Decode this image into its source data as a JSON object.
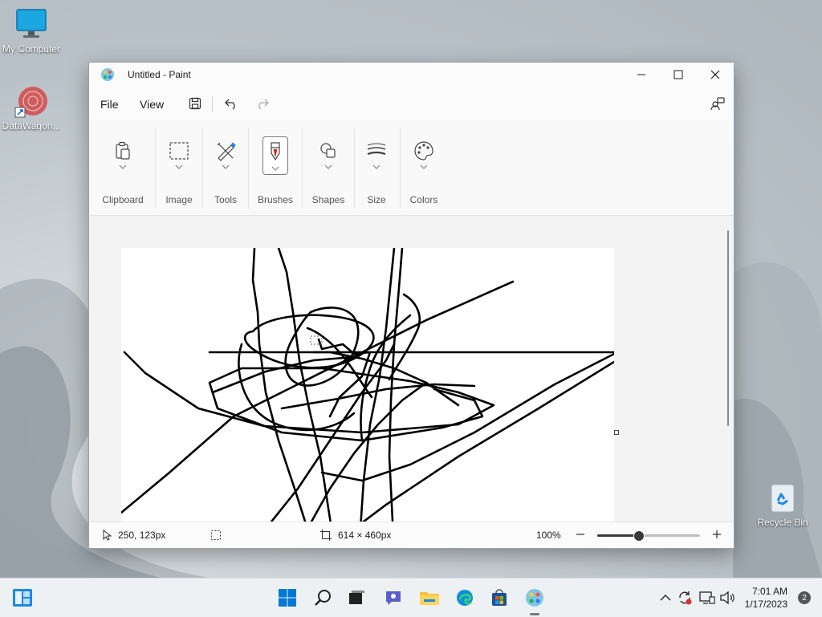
{
  "desktop": {
    "icons": [
      {
        "label": "My Computer"
      },
      {
        "label": "DataWagon..."
      },
      {
        "label": "Recycle Bin"
      }
    ]
  },
  "window": {
    "title": "Untitled - Paint",
    "menu": {
      "file": "File",
      "view": "View"
    },
    "ribbon": {
      "groups": [
        {
          "label": "Clipboard",
          "icon": "clipboard-icon"
        },
        {
          "label": "Image",
          "icon": "select-icon"
        },
        {
          "label": "Tools",
          "icon": "tools-icon"
        },
        {
          "label": "Brushes",
          "icon": "brush-icon"
        },
        {
          "label": "Shapes",
          "icon": "shapes-icon"
        },
        {
          "label": "Size",
          "icon": "size-icon"
        },
        {
          "label": "Colors",
          "icon": "palette-icon"
        }
      ]
    },
    "status": {
      "cursor_pos": "250, 123px",
      "canvas_size": "614 × 460px",
      "zoom": "100%",
      "zoom_fraction": 0.4
    }
  },
  "taskbar": {
    "time": "7:01 AM",
    "date": "1/17/2023",
    "notifications": "2"
  },
  "colors": {
    "accent": "#0067c0",
    "stroke": "#000000"
  }
}
